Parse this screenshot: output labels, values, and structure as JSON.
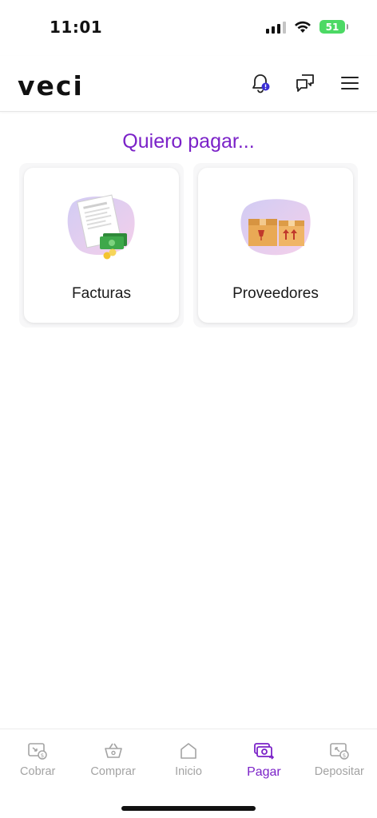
{
  "status_bar": {
    "time": "11:01",
    "battery_level": "51"
  },
  "header": {
    "logo": "veci",
    "icons": [
      "bell-icon",
      "chat-icon",
      "menu-icon"
    ],
    "notification_dot_color": "#3b2fd6"
  },
  "main": {
    "title": "Quiero pagar...",
    "cards": [
      {
        "label": "Facturas",
        "icon": "invoice-icon"
      },
      {
        "label": "Proveedores",
        "icon": "boxes-icon"
      }
    ]
  },
  "bottom_nav": {
    "items": [
      {
        "label": "Cobrar",
        "icon": "cobrar-icon",
        "active": false
      },
      {
        "label": "Comprar",
        "icon": "basket-icon",
        "active": false
      },
      {
        "label": "Inicio",
        "icon": "home-icon",
        "active": false
      },
      {
        "label": "Pagar",
        "icon": "pay-icon",
        "active": true
      },
      {
        "label": "Depositar",
        "icon": "deposit-icon",
        "active": false
      }
    ]
  },
  "colors": {
    "accent": "#7b22c8",
    "inactive": "#a3a3a3",
    "battery": "#4cd964"
  }
}
